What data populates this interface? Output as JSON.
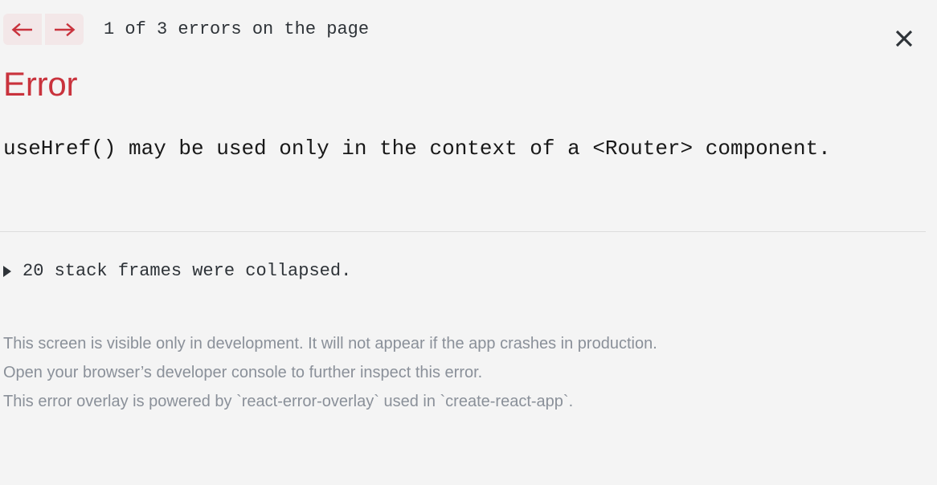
{
  "overlay": {
    "background_color": "#f4f4f4",
    "accent_color": "#c9333d",
    "text_color": "#181818",
    "muted_color": "#8a9099"
  },
  "header": {
    "prev_button": {
      "icon": "arrow-left-icon",
      "label": "←"
    },
    "next_button": {
      "icon": "arrow-right-icon",
      "label": "→"
    },
    "error_count": "1 of 3 errors on the page",
    "close_button": {
      "icon": "close-icon",
      "label": "×"
    }
  },
  "error": {
    "title": "Error",
    "message": "useHref() may be used only in the context of a <Router> component."
  },
  "stack": {
    "disclosure_icon": "triangle-right-icon",
    "collapsed_label": "20 stack frames were collapsed."
  },
  "footer": {
    "line1": "This screen is visible only in development. It will not appear if the app crashes in production.",
    "line2": "Open your browser’s developer console to further inspect this error.",
    "line3": "This error overlay is powered by `react-error-overlay` used in `create-react-app`."
  }
}
